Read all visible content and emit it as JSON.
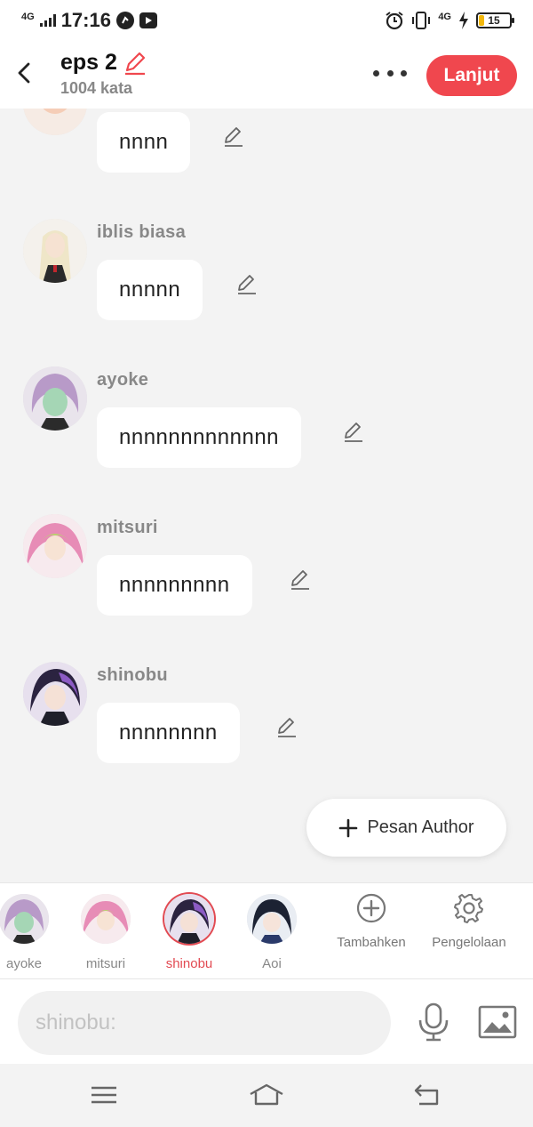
{
  "status_bar": {
    "network_left": "4G",
    "time": "17:16",
    "network_right": "4G",
    "battery_level": "15",
    "icons": [
      "signal-icon",
      "notification-icon",
      "video-notification-icon",
      "alarm-icon",
      "vibrate-icon",
      "charging-icon",
      "battery-icon"
    ]
  },
  "header": {
    "title": "eps 2",
    "word_count": "1004 kata",
    "next_label": "Lanjut",
    "accent_color": "#f0474e"
  },
  "messages": [
    {
      "sender": "",
      "text": "nnnn",
      "avatar_icon": "character-avatar-1"
    },
    {
      "sender": "iblis  biasa",
      "text": "nnnnn",
      "avatar_icon": "character-avatar-iblis"
    },
    {
      "sender": "ayoke",
      "text": "nnnnnnnnnnnnn",
      "avatar_icon": "character-avatar-ayoke"
    },
    {
      "sender": "mitsuri",
      "text": "nnnnnnnnn",
      "avatar_icon": "character-avatar-mitsuri"
    },
    {
      "sender": "shinobu",
      "text": "nnnnnnnn",
      "avatar_icon": "character-avatar-shinobu"
    }
  ],
  "author_message_label": "Pesan Author",
  "characters": [
    {
      "name": "ayoke",
      "active": false
    },
    {
      "name": "mitsuri",
      "active": false
    },
    {
      "name": "shinobu",
      "active": true
    },
    {
      "name": "Aoi",
      "active": false
    }
  ],
  "tools": {
    "add_label": "Tambahken",
    "manage_label": "Pengelolaan"
  },
  "composer": {
    "placeholder": "shinobu:"
  },
  "nav": {
    "icons": [
      "menu-icon",
      "home-icon",
      "back-nav-icon"
    ]
  }
}
